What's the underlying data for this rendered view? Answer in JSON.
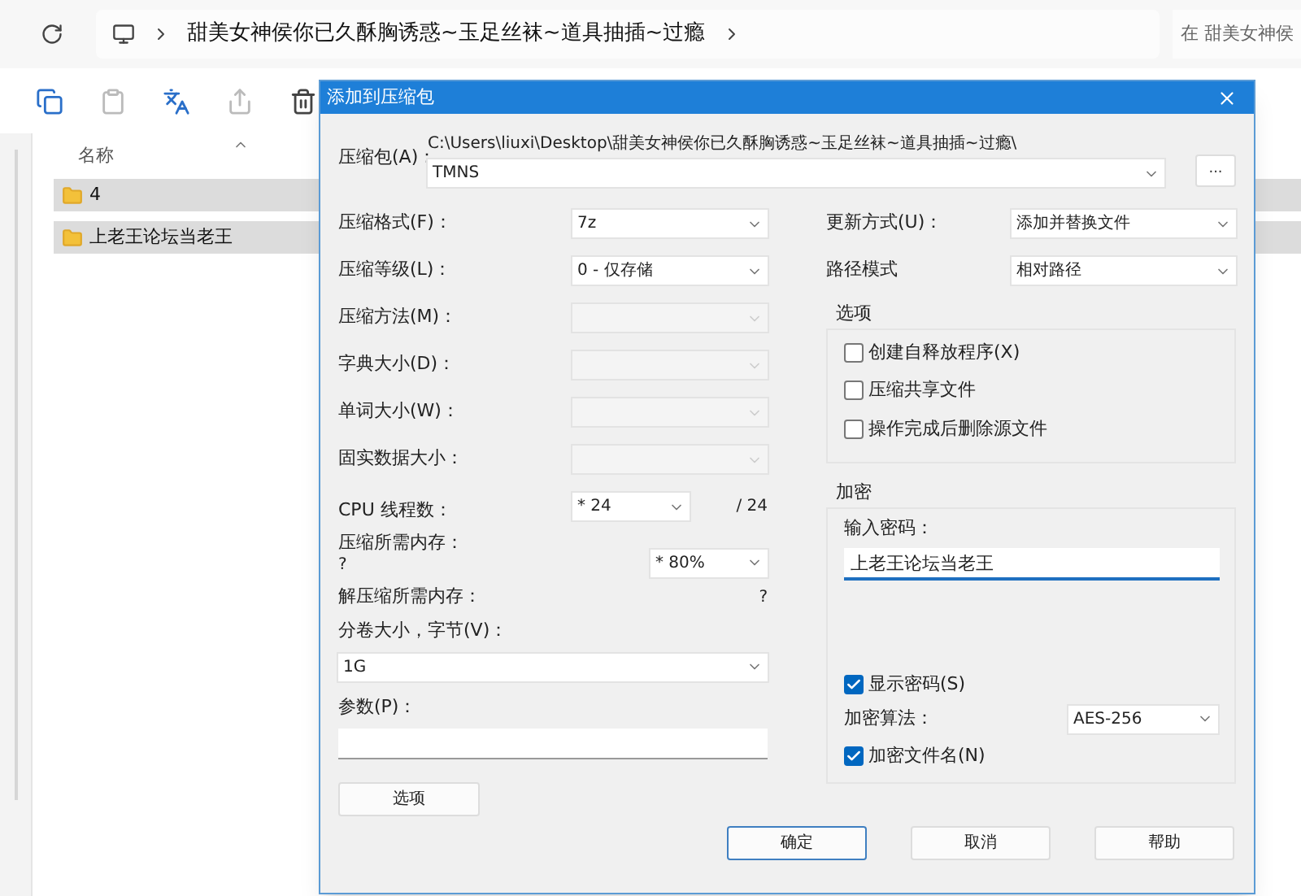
{
  "explorer": {
    "address_path": "甜美女神侯你已久酥胸诱惑~玉足丝袜~道具抽插~过瘾",
    "search_placeholder": "在 甜美女神侯",
    "column_header": "名称",
    "files": [
      {
        "name": "4",
        "selected": true
      },
      {
        "name": "上老王论坛当老王",
        "selected": true
      }
    ]
  },
  "dialog": {
    "title": "添加到压缩包",
    "archive": {
      "label": "压缩包(A)：",
      "path": "C:\\Users\\liuxi\\Desktop\\甜美女神侯你已久酥胸诱惑~玉足丝袜~道具抽插~过瘾\\",
      "value": "TMNS"
    },
    "browse_button": "...",
    "left_fields": [
      {
        "kind": "select",
        "label": "压缩格式(F)：",
        "value": "7z",
        "disabled": false
      },
      {
        "kind": "select",
        "label": "压缩等级(L)：",
        "value": "0 - 仅存储",
        "disabled": false
      },
      {
        "kind": "select",
        "label": "压缩方法(M)：",
        "disabled": true
      },
      {
        "kind": "select",
        "label": "字典大小(D)：",
        "disabled": true
      },
      {
        "kind": "select",
        "label": "单词大小(W)：",
        "disabled": true
      },
      {
        "kind": "select",
        "label": "固实数据大小：",
        "disabled": true
      },
      {
        "kind": "threads",
        "label": "CPU 线程数：",
        "value": "* 24",
        "suffix": "/ 24",
        "disabled": false
      },
      {
        "kind": "memory",
        "label": "压缩所需内存：",
        "note": "?",
        "value": "* 80%",
        "disabled": false
      },
      {
        "kind": "info",
        "label": "解压缩所需内存：",
        "note": "?"
      },
      {
        "kind": "wide-select",
        "label": "分卷大小，字节(V)：",
        "value": "1G",
        "disabled": false
      },
      {
        "kind": "wide-input",
        "label": "参数(P)："
      }
    ],
    "options_button": "选项",
    "right_fields": [
      {
        "label": "更新方式(U)：",
        "value": "添加并替换文件"
      },
      {
        "label": "路径模式",
        "value": "相对路径"
      }
    ],
    "options_group": {
      "title": "选项",
      "checkboxes": [
        {
          "label": "创建自释放程序(X)",
          "checked": false
        },
        {
          "label": "压缩共享文件",
          "checked": false
        },
        {
          "label": "操作完成后删除源文件",
          "checked": false
        }
      ]
    },
    "encryption": {
      "title": "加密",
      "password_label": "输入密码：",
      "password": "上老王论坛当老王",
      "show_password": {
        "label": "显示密码(S)",
        "checked": true
      },
      "algorithm": {
        "label": "加密算法：",
        "value": "AES-256"
      },
      "encrypt_names": {
        "label": "加密文件名(N)",
        "checked": true
      }
    },
    "buttons": [
      {
        "label": "确定",
        "default": true
      },
      {
        "label": "取消",
        "default": false
      },
      {
        "label": "帮助",
        "default": false
      }
    ]
  }
}
